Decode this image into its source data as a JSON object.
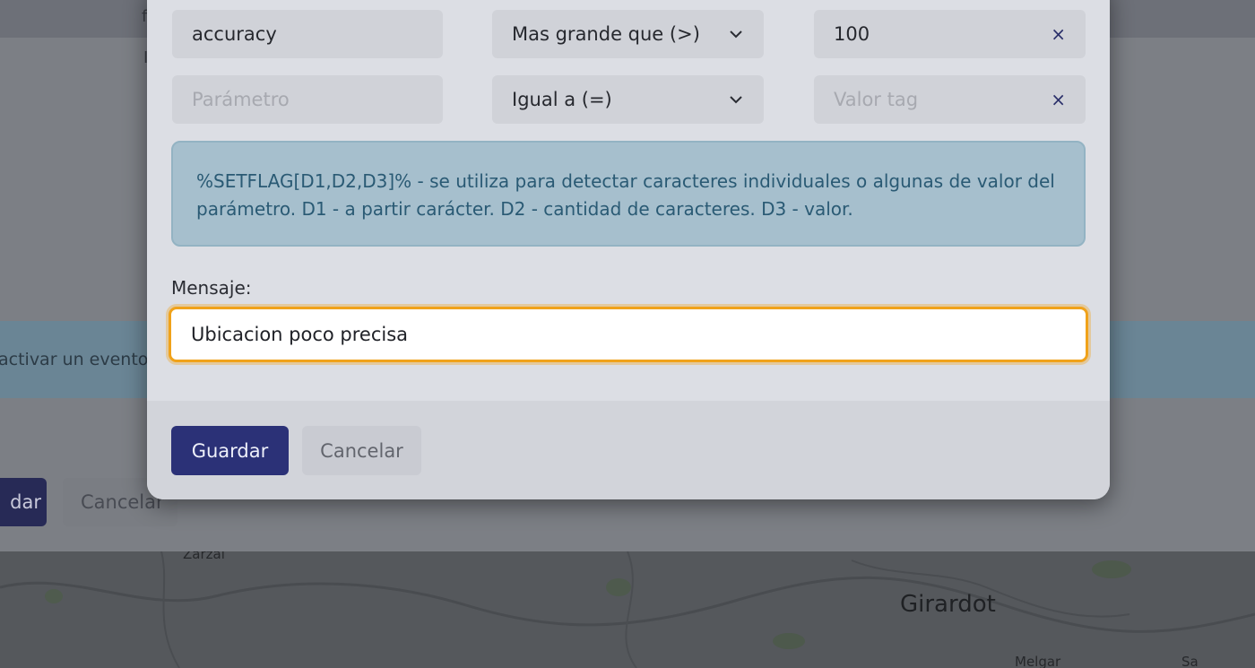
{
  "background": {
    "info_text": "activar un evento,",
    "save_label_fragment": "dar",
    "cancel_label": "Cancelar",
    "map": {
      "city_label": "Girardot",
      "labels": [
        "Zarzal",
        "Melgar",
        "Sa"
      ]
    }
  },
  "modal": {
    "conditions": [
      {
        "parameter": "accuracy",
        "parameter_placeholder": "Parámetro",
        "operator": "Mas grande que (>)",
        "value": "100",
        "value_placeholder": "Valor tag",
        "remove": "×"
      },
      {
        "parameter": "",
        "parameter_placeholder": "Parámetro",
        "operator": "Igual a (=)",
        "value": "",
        "value_placeholder": "Valor tag",
        "remove": "×"
      }
    ],
    "alert_text": "%SETFLAG[D1,D2,D3]% - se utiliza para detectar caracteres individuales o algunas de valor del parámetro. D1 - a partir carácter. D2 - cantidad de caracteres. D3 - valor.",
    "message_label": "Mensaje:",
    "message_value": "Ubicacion poco precisa",
    "save_label": "Guardar",
    "cancel_label": "Cancelar"
  },
  "colors": {
    "primary": "#2b3177",
    "focus_ring": "#f0a21a",
    "info_bg": "#a6bfcd",
    "info_text": "#2a5a74"
  }
}
